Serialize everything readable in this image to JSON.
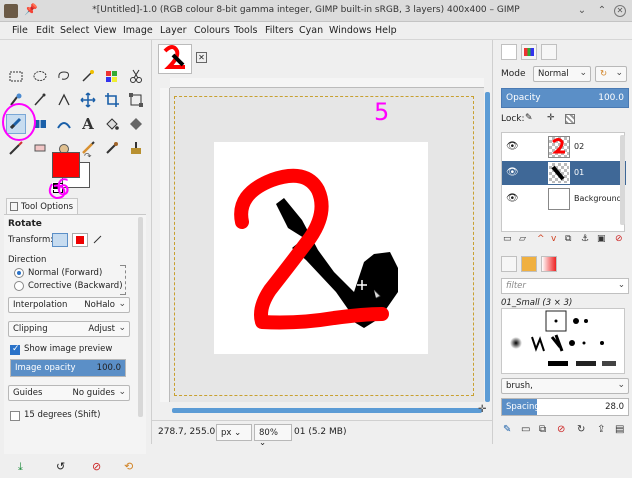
{
  "window": {
    "title": "*[Untitled]-1.0 (RGB colour 8-bit gamma integer, GIMP built-in sRGB, 3 layers) 400x400 – GIMP"
  },
  "menu": [
    "File",
    "Edit",
    "Select",
    "View",
    "Image",
    "Layer",
    "Colours",
    "Tools",
    "Filters",
    "Cyan",
    "Windows",
    "Help"
  ],
  "colors": {
    "fg": "#ff0000",
    "bg": "#ffffff",
    "accent": "#5b8fc7",
    "selected_layer": "#3f6897",
    "annotation": "#ff00ff"
  },
  "tool_options": {
    "tab_label": "Tool Options",
    "tool_name": "Rotate",
    "transform_label": "Transform:",
    "direction_label": "Direction",
    "direction_normal": "Normal (Forward)",
    "direction_corrective": "Corrective (Backward)",
    "interpolation_label": "Interpolation",
    "interpolation_value": "NoHalo",
    "clipping_label": "Clipping",
    "clipping_value": "Adjust",
    "show_preview_label": "Show image preview",
    "image_opacity_label": "Image opacity",
    "image_opacity_value": "100.0",
    "image_opacity_fraction": 1.0,
    "guides_label": "Guides",
    "guides_value": "No guides",
    "degrees_label": "15 degrees (Shift)"
  },
  "annotations": {
    "number_6": "6",
    "number_5": "5"
  },
  "status": {
    "coords": "278.7, 255.0",
    "unit": "px",
    "zoom": "80%",
    "info": "01 (5.2 MB)"
  },
  "layers_panel": {
    "mode_label": "Mode",
    "mode_value": "Normal",
    "opacity_label": "Opacity",
    "opacity_value": "100.0",
    "lock_label": "Lock:",
    "layers": [
      {
        "name": "02",
        "selected": false
      },
      {
        "name": "01",
        "selected": true
      },
      {
        "name": "Background",
        "selected": false
      }
    ]
  },
  "brushes_panel": {
    "filter_placeholder": "filter",
    "brush_name": "01_Small (3 × 3)",
    "preset_value": "brush,",
    "spacing_label": "Spacing",
    "spacing_value": "28.0",
    "spacing_fraction": 0.28
  }
}
